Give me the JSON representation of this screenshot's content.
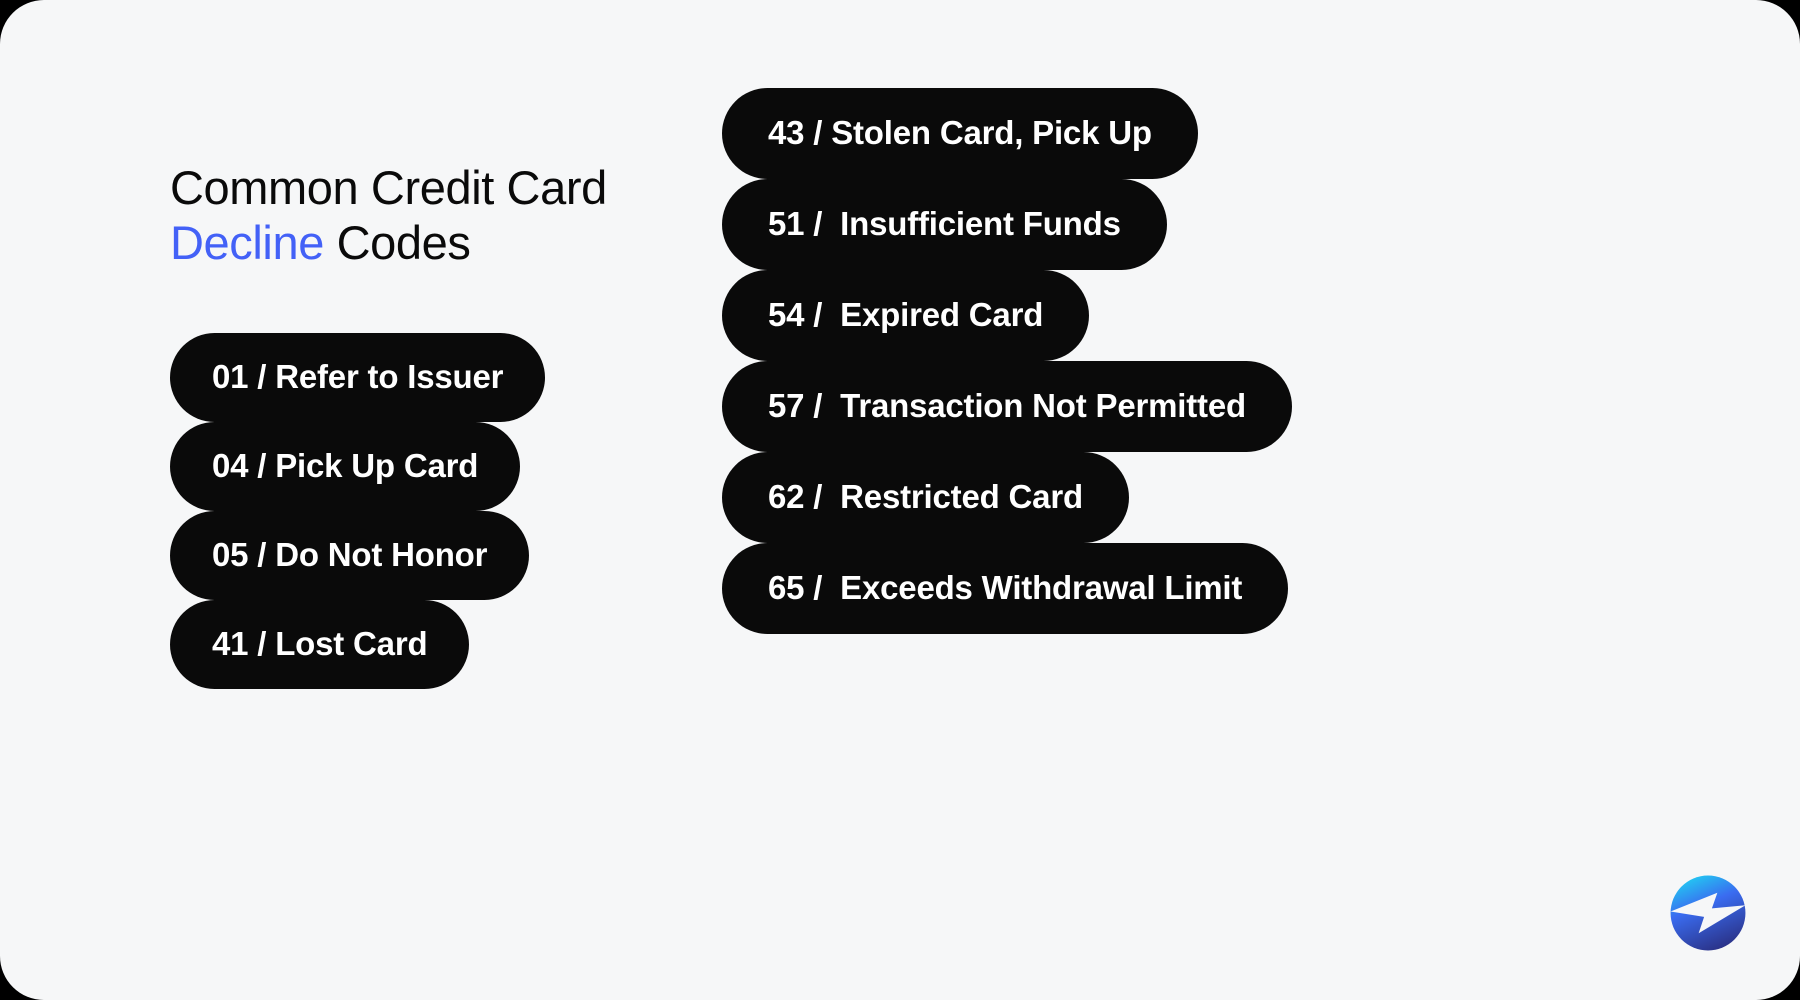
{
  "card": {
    "background_color": "#f6f7f8",
    "outer_background_color": "#000000",
    "corner_radius_px": 44
  },
  "title": {
    "line1_prefix": "Common Credit Card",
    "accent_word": "Decline",
    "line2_suffix": " Codes",
    "full_text": "Common Credit Card Decline Codes",
    "accent_color": "#4361f7",
    "text_color": "#0a0a0a"
  },
  "pill_style": {
    "background_color": "#0a0a0a",
    "text_color": "#ffffff"
  },
  "columns": {
    "left": {
      "items": [
        {
          "code": "01",
          "separator": "/",
          "label": "Refer to Issuer",
          "text": "01 / Refer to Issuer"
        },
        {
          "code": "04",
          "separator": "/",
          "label": "Pick Up Card",
          "text": "04 / Pick Up Card"
        },
        {
          "code": "05",
          "separator": "/",
          "label": "Do Not Honor",
          "text": "05 / Do Not Honor"
        },
        {
          "code": "41",
          "separator": "/",
          "label": "Lost Card",
          "text": "41 / Lost Card"
        }
      ]
    },
    "right": {
      "items": [
        {
          "code": "43",
          "separator": "/",
          "label": "Stolen Card, Pick Up",
          "text": "43 / Stolen Card, Pick Up"
        },
        {
          "code": "51",
          "separator": "/",
          "label": "Insufficient Funds",
          "text": "51 /  Insufficient Funds"
        },
        {
          "code": "54",
          "separator": "/",
          "label": "Expired Card",
          "text": "54 /  Expired Card"
        },
        {
          "code": "57",
          "separator": "/",
          "label": "Transaction Not Permitted",
          "text": "57 /  Transaction Not Permitted"
        },
        {
          "code": "62",
          "separator": "/",
          "label": "Restricted Card",
          "text": "62 /  Restricted Card"
        },
        {
          "code": "65",
          "separator": "/",
          "label": "Exceeds Withdrawal Limit",
          "text": "65 /  Exceeds Withdrawal Limit"
        }
      ]
    }
  },
  "logo": {
    "icon": "lightning-bolt-circle-logo",
    "gradient_start": "#22c9f2",
    "gradient_mid": "#3a6cf0",
    "gradient_end": "#2a2f82",
    "bolt_color": "#ffffff"
  }
}
